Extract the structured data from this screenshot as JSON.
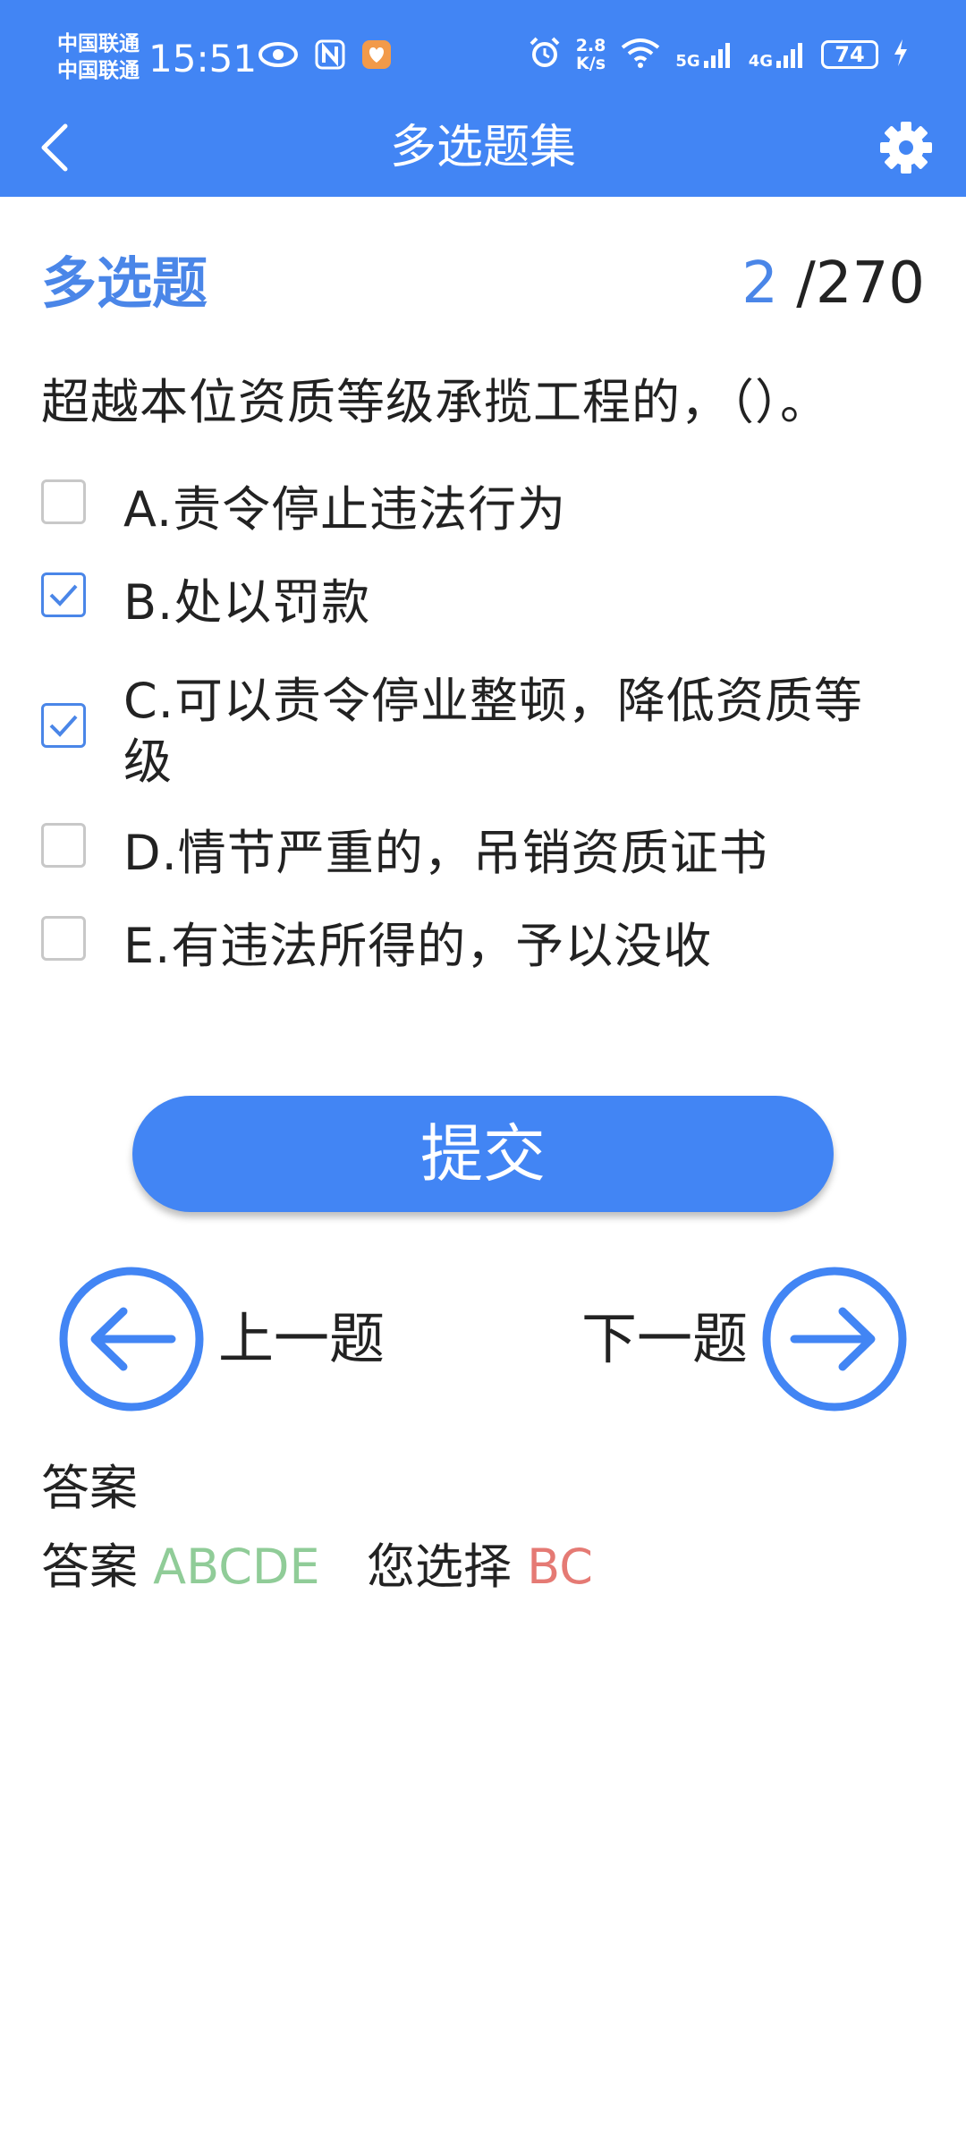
{
  "status_bar": {
    "carrier_1": "中国联通",
    "carrier_2": "中国联通",
    "time": "15:51",
    "net_speed_value": "2.8",
    "net_speed_unit": "K/s",
    "signal_1": "5G",
    "signal_2": "4G",
    "battery": "74",
    "icons": [
      "eye-icon",
      "nfc-icon",
      "app-notification-icon",
      "alarm-icon",
      "wifi-icon",
      "signal-icon",
      "battery-icon",
      "charging-icon"
    ]
  },
  "toolbar": {
    "title": "多选题集",
    "back_icon": "chevron-left-icon",
    "settings_icon": "gear-icon"
  },
  "question": {
    "type": "多选题",
    "current": "2",
    "total": "/270",
    "text": "超越本位资质等级承揽工程的，（）。",
    "options": [
      {
        "label": "A.责令停止违法行为",
        "checked": false
      },
      {
        "label": "B.处以罚款",
        "checked": true
      },
      {
        "label": "C.可以责令停业整顿，降低资质等级",
        "checked": true
      },
      {
        "label": "D.情节严重的，吊销资质证书",
        "checked": false
      },
      {
        "label": "E.有违法所得的，予以没收",
        "checked": false
      }
    ]
  },
  "actions": {
    "submit_label": "提交",
    "prev_label": "上一题",
    "next_label": "下一题"
  },
  "answer": {
    "title": "答案",
    "answer_prefix": "答案",
    "correct": "ABCDE",
    "chosen_prefix": "您选择",
    "chosen": "BC"
  },
  "colors": {
    "primary": "#4285f4",
    "correct": "#90cc98",
    "wrong": "#e57a74"
  }
}
